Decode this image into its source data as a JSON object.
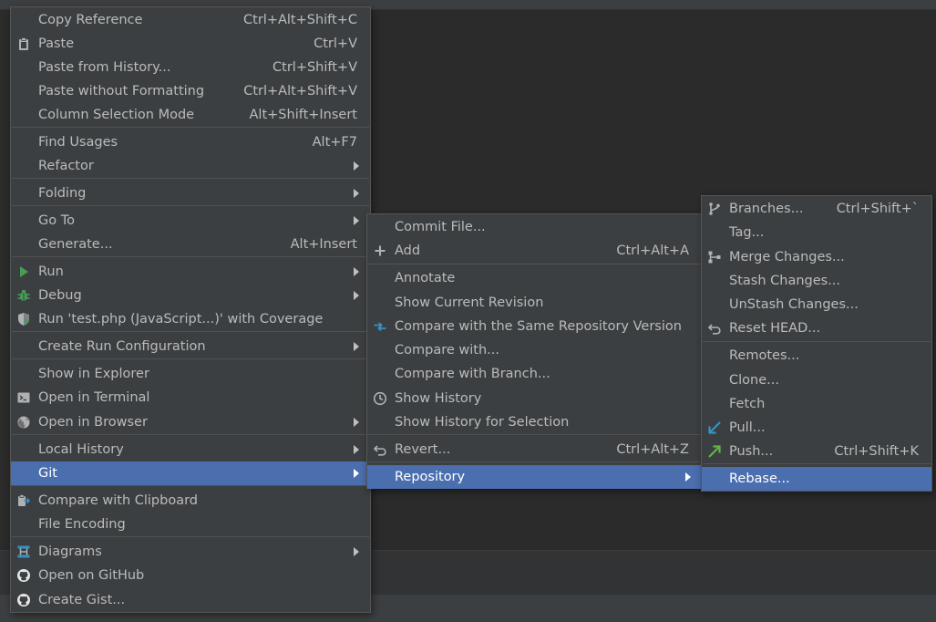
{
  "menu1": {
    "items": [
      {
        "label": "Copy Reference",
        "shortcut": "Ctrl+Alt+Shift+C"
      },
      {
        "label": "Paste",
        "shortcut": "Ctrl+V",
        "icon": "clipboard-icon"
      },
      {
        "label": "Paste from History...",
        "shortcut": "Ctrl+Shift+V"
      },
      {
        "label": "Paste without Formatting",
        "shortcut": "Ctrl+Alt+Shift+V"
      },
      {
        "label": "Column Selection Mode",
        "shortcut": "Alt+Shift+Insert"
      },
      {
        "label": "Find Usages",
        "shortcut": "Alt+F7"
      },
      {
        "label": "Refactor",
        "submenu": true
      },
      {
        "label": "Folding",
        "submenu": true
      },
      {
        "label": "Go To",
        "submenu": true
      },
      {
        "label": "Generate...",
        "shortcut": "Alt+Insert"
      },
      {
        "label": "Run",
        "submenu": true,
        "icon": "run-icon"
      },
      {
        "label": "Debug",
        "submenu": true,
        "icon": "debug-icon"
      },
      {
        "label": "Run 'test.php (JavaScript...)' with Coverage",
        "icon": "coverage-icon"
      },
      {
        "label": "Create Run Configuration",
        "submenu": true
      },
      {
        "label": "Show in Explorer"
      },
      {
        "label": "Open in Terminal",
        "icon": "terminal-icon"
      },
      {
        "label": "Open in Browser",
        "submenu": true,
        "icon": "globe-icon"
      },
      {
        "label": "Local History",
        "submenu": true
      },
      {
        "label": "Git",
        "submenu": true,
        "selected": true
      },
      {
        "label": "Compare with Clipboard",
        "icon": "compare-clipboard-icon"
      },
      {
        "label": "File Encoding"
      },
      {
        "label": "Diagrams",
        "submenu": true,
        "icon": "diagram-icon"
      },
      {
        "label": "Open on GitHub",
        "icon": "github-icon"
      },
      {
        "label": "Create Gist...",
        "icon": "github-icon"
      }
    ]
  },
  "menu2": {
    "items": [
      {
        "label": "Commit File..."
      },
      {
        "label": "Add",
        "shortcut": "Ctrl+Alt+A",
        "icon": "plus-icon"
      },
      {
        "label": "Annotate"
      },
      {
        "label": "Show Current Revision"
      },
      {
        "label": "Compare with the Same Repository Version",
        "icon": "compare-arrows-icon"
      },
      {
        "label": "Compare with..."
      },
      {
        "label": "Compare with Branch..."
      },
      {
        "label": "Show History",
        "icon": "clock-icon"
      },
      {
        "label": "Show History for Selection"
      },
      {
        "label": "Revert...",
        "shortcut": "Ctrl+Alt+Z",
        "icon": "undo-icon"
      },
      {
        "label": "Repository",
        "submenu": true,
        "selected": true
      }
    ]
  },
  "menu3": {
    "items": [
      {
        "label": "Branches...",
        "shortcut": "Ctrl+Shift+`",
        "icon": "branch-icon"
      },
      {
        "label": "Tag..."
      },
      {
        "label": "Merge Changes...",
        "icon": "merge-icon"
      },
      {
        "label": "Stash Changes..."
      },
      {
        "label": "UnStash Changes..."
      },
      {
        "label": "Reset HEAD...",
        "icon": "undo-icon"
      },
      {
        "label": "Remotes..."
      },
      {
        "label": "Clone..."
      },
      {
        "label": "Fetch"
      },
      {
        "label": "Pull...",
        "icon": "pull-arrow-icon"
      },
      {
        "label": "Push...",
        "shortcut": "Ctrl+Shift+K",
        "icon": "push-arrow-icon"
      },
      {
        "label": "Rebase...",
        "selected": true
      }
    ]
  },
  "colors": {
    "menu_bg": "#3c3f41",
    "selection": "#4b6eaf",
    "text": "#bbbbbb",
    "run_green": "#499c54",
    "accent_blue": "#3592c4"
  }
}
